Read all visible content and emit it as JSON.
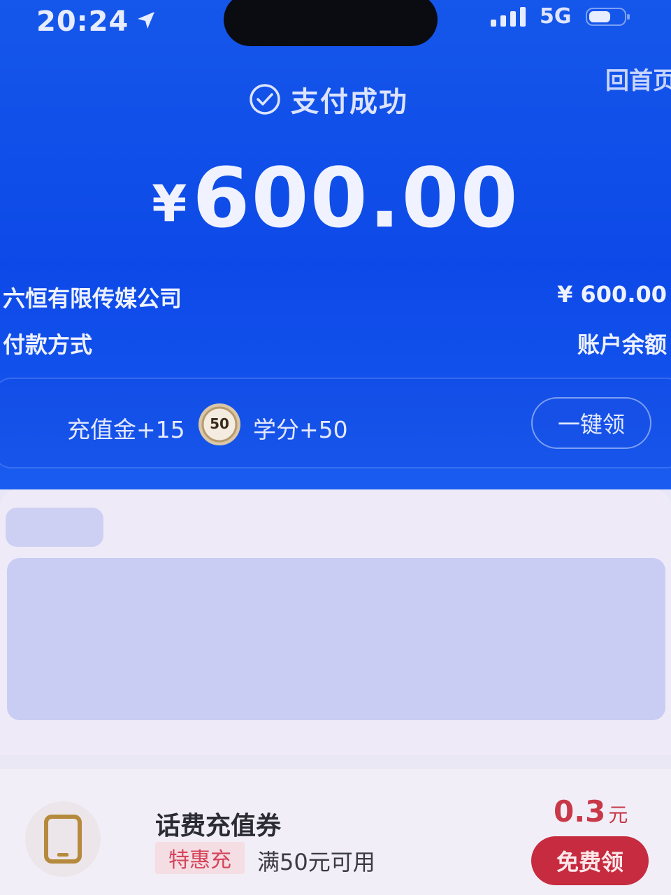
{
  "status_bar": {
    "time": "20:24",
    "network": "5G",
    "icons": [
      "location-arrow-icon",
      "signal-icon",
      "battery-icon"
    ]
  },
  "header": {
    "home_link": "回首页",
    "status_text": "支付成功",
    "status_icon": "check-circle-icon"
  },
  "payment": {
    "currency_symbol": "¥",
    "amount": "600.00",
    "merchant": "六恒有限传媒公司",
    "merchant_amount": "¥ 600.00",
    "method_label": "付款方式",
    "method_value": "账户余额"
  },
  "rewards": {
    "recharge_bonus": "充值金+15",
    "coin_badge": "50",
    "credit_bonus": "学分+50",
    "claim_all_label": "一键领"
  },
  "coupon": {
    "icon": "phone-icon",
    "title": "话费充值券",
    "tag": "特惠充",
    "condition": "满50元可用",
    "value": "0.3",
    "unit": "元",
    "claim_label": "免费领"
  },
  "colors": {
    "header_blue": "#0d49e8",
    "accent_red": "#c62b3f",
    "panel_bg": "#eeeaf8"
  }
}
